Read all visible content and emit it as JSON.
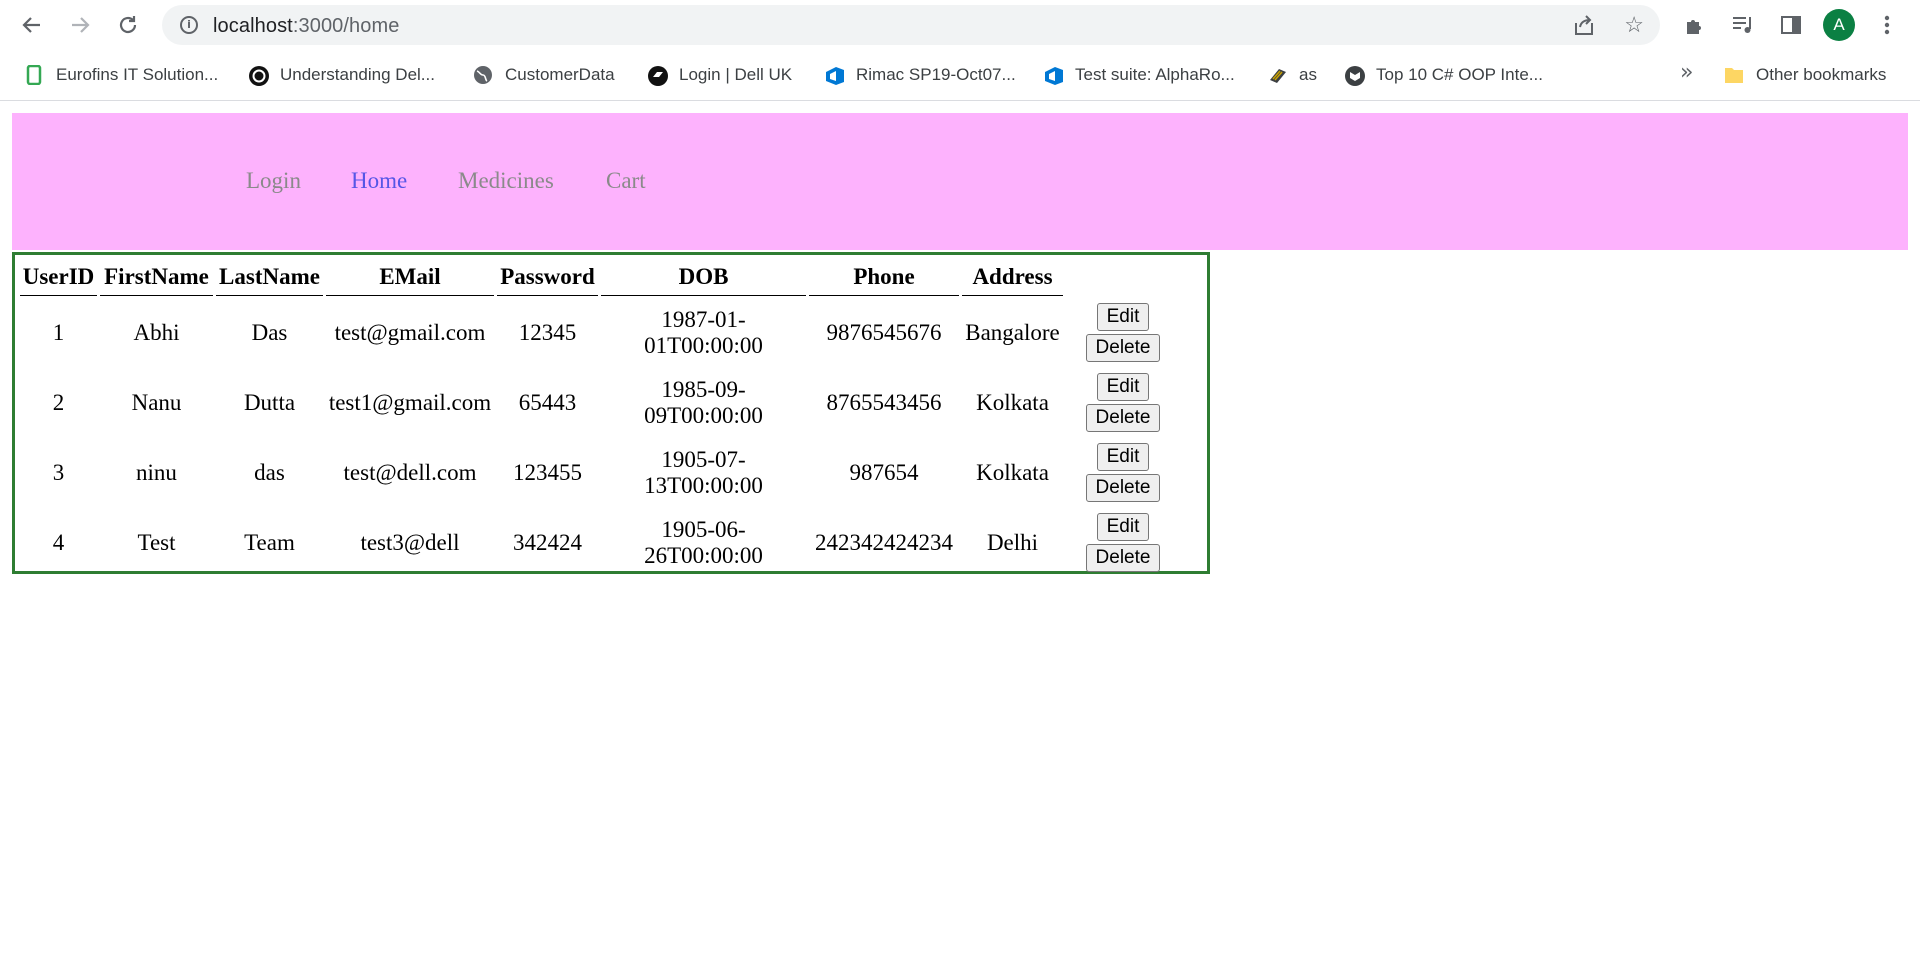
{
  "browser": {
    "url_host": "localhost",
    "url_path": ":3000/home",
    "profile_initial": "A",
    "bookmarks": [
      {
        "label": "Eurofins IT Solution...",
        "icon": "eurofins-icon"
      },
      {
        "label": "Understanding Del...",
        "icon": "circle-logo-icon"
      },
      {
        "label": "CustomerData",
        "icon": "globe-icon"
      },
      {
        "label": "Login | Dell UK",
        "icon": "dell-login-icon"
      },
      {
        "label": "Rimac SP19-Oct07...",
        "icon": "azure-devops-icon"
      },
      {
        "label": "Test suite: AlphaRo...",
        "icon": "azure-devops-icon"
      },
      {
        "label": "as",
        "icon": "flag-icon"
      },
      {
        "label": "Top 10 C# OOP Inte...",
        "icon": "shield-logo-icon"
      }
    ],
    "more_label": "»",
    "other_bookmarks": "Other bookmarks"
  },
  "nav": {
    "items": [
      {
        "label": "Login"
      },
      {
        "label": "Home"
      },
      {
        "label": "Medicines"
      },
      {
        "label": "Cart"
      }
    ],
    "active": "Home",
    "bg_color": "#fdb2fd"
  },
  "table": {
    "headers": [
      "UserID",
      "FirstName",
      "LastName",
      "EMail",
      "Password",
      "DOB",
      "Phone",
      "Address",
      ""
    ],
    "edit_label": "Edit",
    "delete_label": "Delete",
    "rows": [
      {
        "id": "1",
        "first": "Abhi",
        "last": "Das",
        "email": "test@gmail.com",
        "password": "12345",
        "dob_1": "1987-01-",
        "dob_2": "01T00:00:00",
        "phone": "9876545676",
        "address": "Bangalore"
      },
      {
        "id": "2",
        "first": "Nanu",
        "last": "Dutta",
        "email": "test1@gmail.com",
        "password": "65443",
        "dob_1": "1985-09-",
        "dob_2": "09T00:00:00",
        "phone": "8765543456",
        "address": "Kolkata"
      },
      {
        "id": "3",
        "first": "ninu",
        "last": "das",
        "email": "test@dell.com",
        "password": "123455",
        "dob_1": "1905-07-",
        "dob_2": "13T00:00:00",
        "phone": "987654",
        "address": "Kolkata"
      },
      {
        "id": "4",
        "first": "Test",
        "last": "Team",
        "email": "test3@dell",
        "password": "342424",
        "dob_1": "1905-06-",
        "dob_2": "26T00:00:00",
        "phone": "242342424234",
        "address": "Delhi"
      }
    ],
    "border_color": "#2e7d32"
  }
}
